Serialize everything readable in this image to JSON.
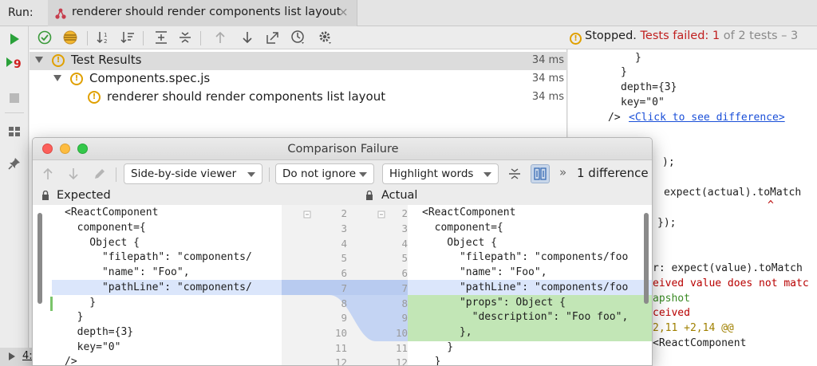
{
  "run_bar": {
    "run_label": "Run:",
    "tab_title": "renderer should render components list layout",
    "close_glyph": "×"
  },
  "toolbar": {
    "status_prefix": "Stopped.",
    "status_failed": "Tests failed:",
    "status_failed_count": "1",
    "status_total": "of 2 tests – 3"
  },
  "tree": {
    "rows": [
      {
        "label": "Test Results",
        "time": "34 ms"
      },
      {
        "label": "Components.spec.js",
        "time": "34 ms"
      },
      {
        "label": "renderer should render components list layout",
        "time": "34 ms"
      }
    ]
  },
  "console": {
    "lines": [
      "}",
      "}",
      "depth={3}",
      "key=\"0\"",
      "/>",
      "<Click to see difference>",
      ");",
      "expect(actual).toMatch",
      "^",
      "});",
      "r: expect(value).toMatch",
      "eived value does not matc",
      "apshot",
      "ceived",
      "2,11 +2,14 @@",
      "<ReactComponent"
    ]
  },
  "bottom": {
    "label": "4:"
  },
  "dialog": {
    "title": "Comparison Failure",
    "viewer": "Side-by-side viewer",
    "ignore": "Do not ignore",
    "highlight": "Highlight words",
    "chevrons": "»",
    "diff_count": "1 difference",
    "expected_label": "Expected",
    "actual_label": "Actual",
    "left_lines": [
      "<ReactComponent",
      "  component={",
      "    Object {",
      "      \"filepath\": \"components/",
      "      \"name\": \"Foo\",",
      "      \"pathLine\": \"components/",
      "    }",
      "  }",
      "  depth={3}",
      "  key=\"0\"",
      "/>"
    ],
    "left_numbers": [
      "2",
      "3",
      "4",
      "5",
      "6",
      "7",
      "8",
      "9",
      "10",
      "11",
      "12"
    ],
    "right_numbers": [
      "2",
      "3",
      "4",
      "5",
      "6",
      "7",
      "8",
      "9",
      "10",
      "11",
      "12"
    ],
    "right_lines": [
      "<ReactComponent",
      "  component={",
      "    Object {",
      "      \"filepath\": \"components/foo",
      "      \"name\": \"Foo\",",
      "      \"pathLine\": \"components/foo",
      "      \"props\": Object {",
      "        \"description\": \"Foo foo\",",
      "      },",
      "    }",
      "  }"
    ]
  },
  "colors": {
    "changed_blue": "#dbe6fb",
    "inserted_green": "#c2e6b6",
    "warning": "#e0a000",
    "failed_red": "#c02020",
    "run_green": "#2aa13a"
  }
}
